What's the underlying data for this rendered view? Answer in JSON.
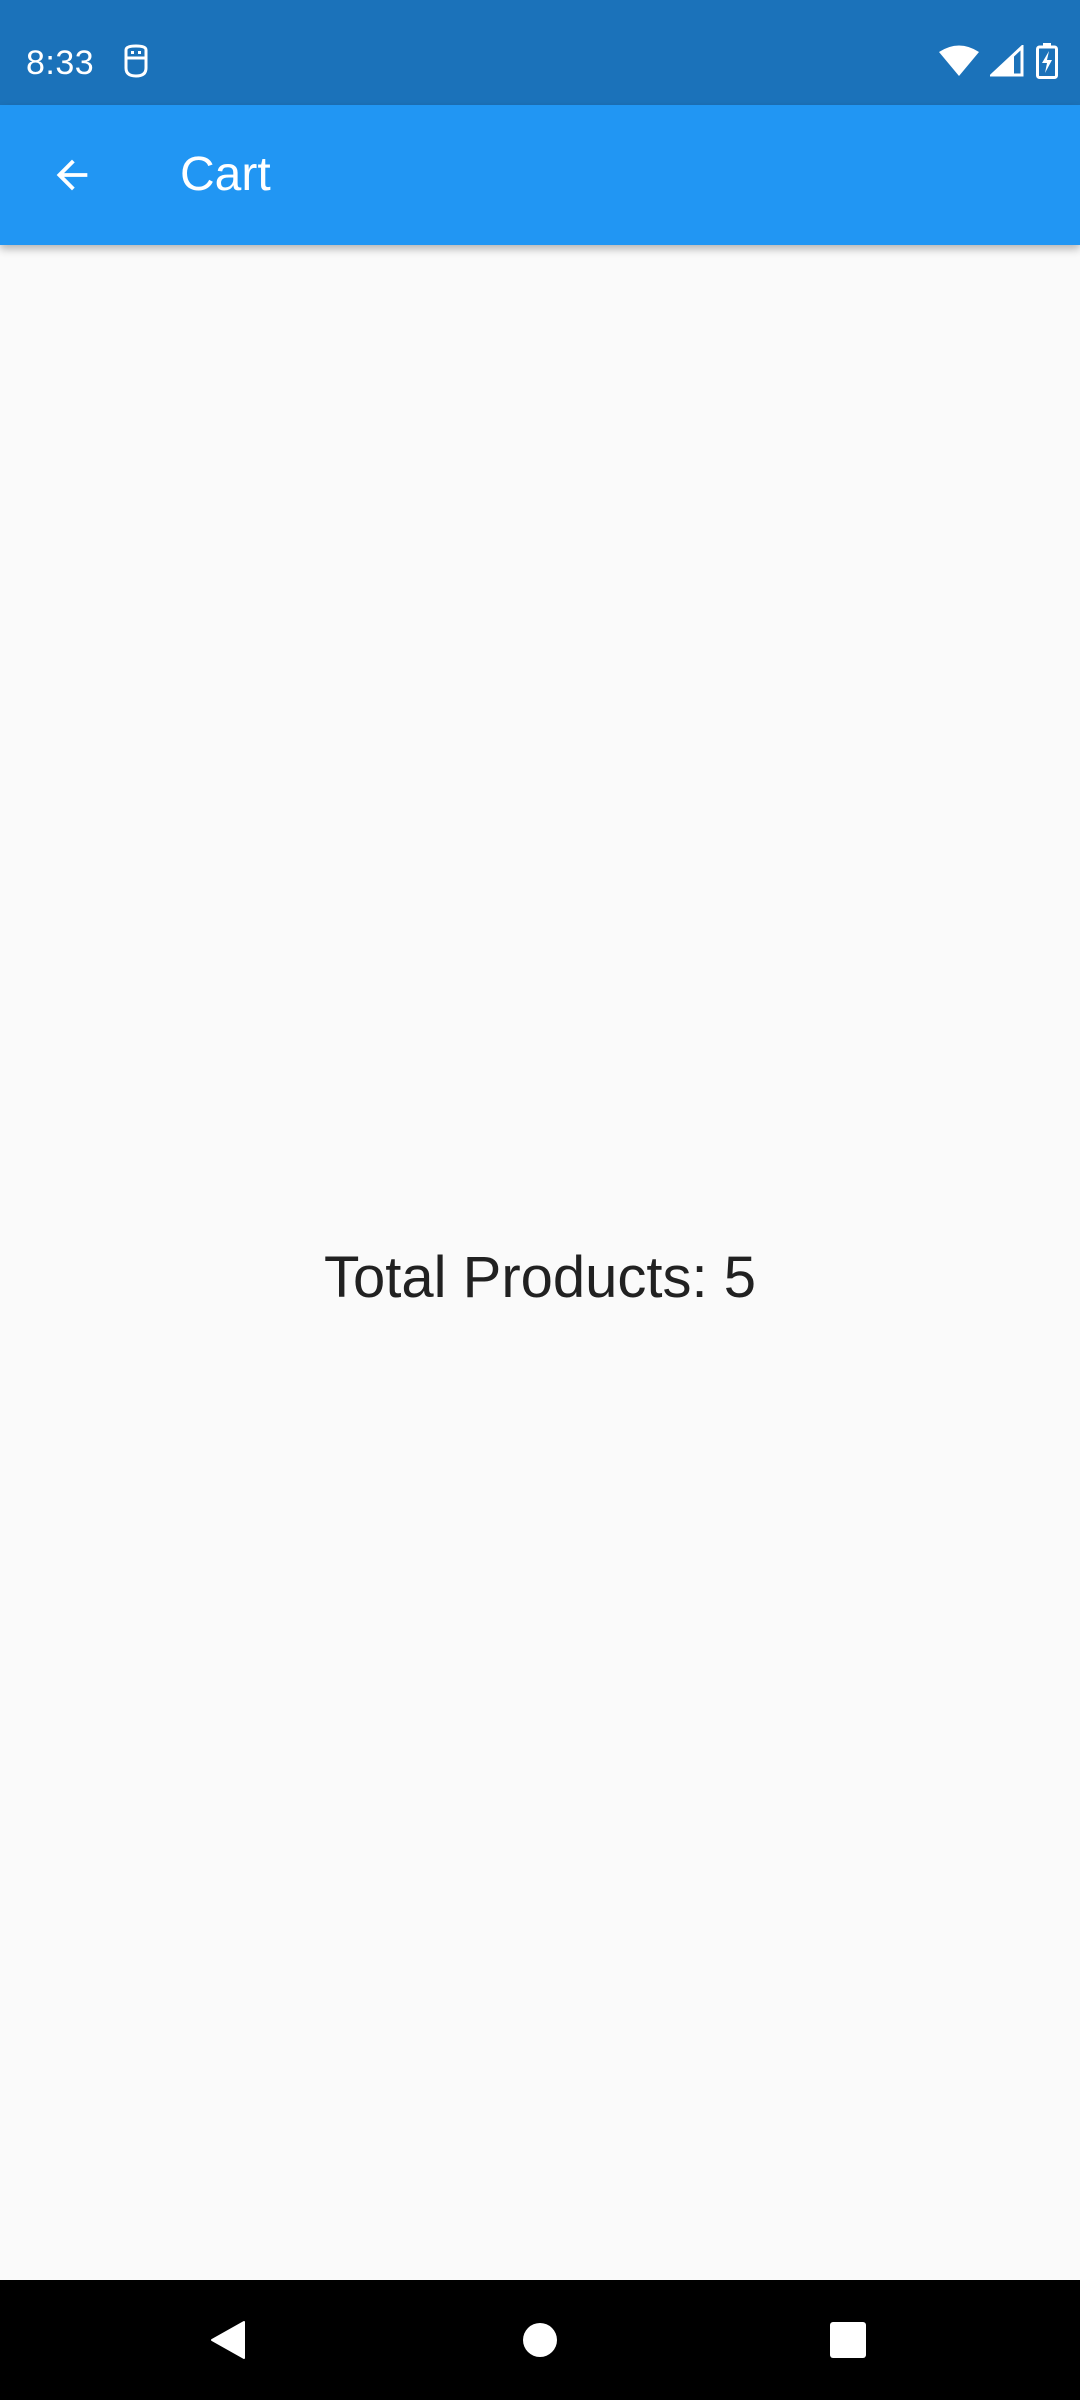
{
  "status_bar": {
    "time": "8:33",
    "icons": [
      "debug-icon",
      "wifi-icon",
      "signal-icon",
      "battery-charging-icon"
    ],
    "background_color": "#1b72ba"
  },
  "app_bar": {
    "title": "Cart",
    "back_icon": "arrow-back-icon",
    "background_color": "#2196f3"
  },
  "main": {
    "total_products_text": "Total Products: 5"
  },
  "nav_bar": {
    "icons": [
      "nav-back-icon",
      "nav-home-icon",
      "nav-recents-icon"
    ]
  }
}
